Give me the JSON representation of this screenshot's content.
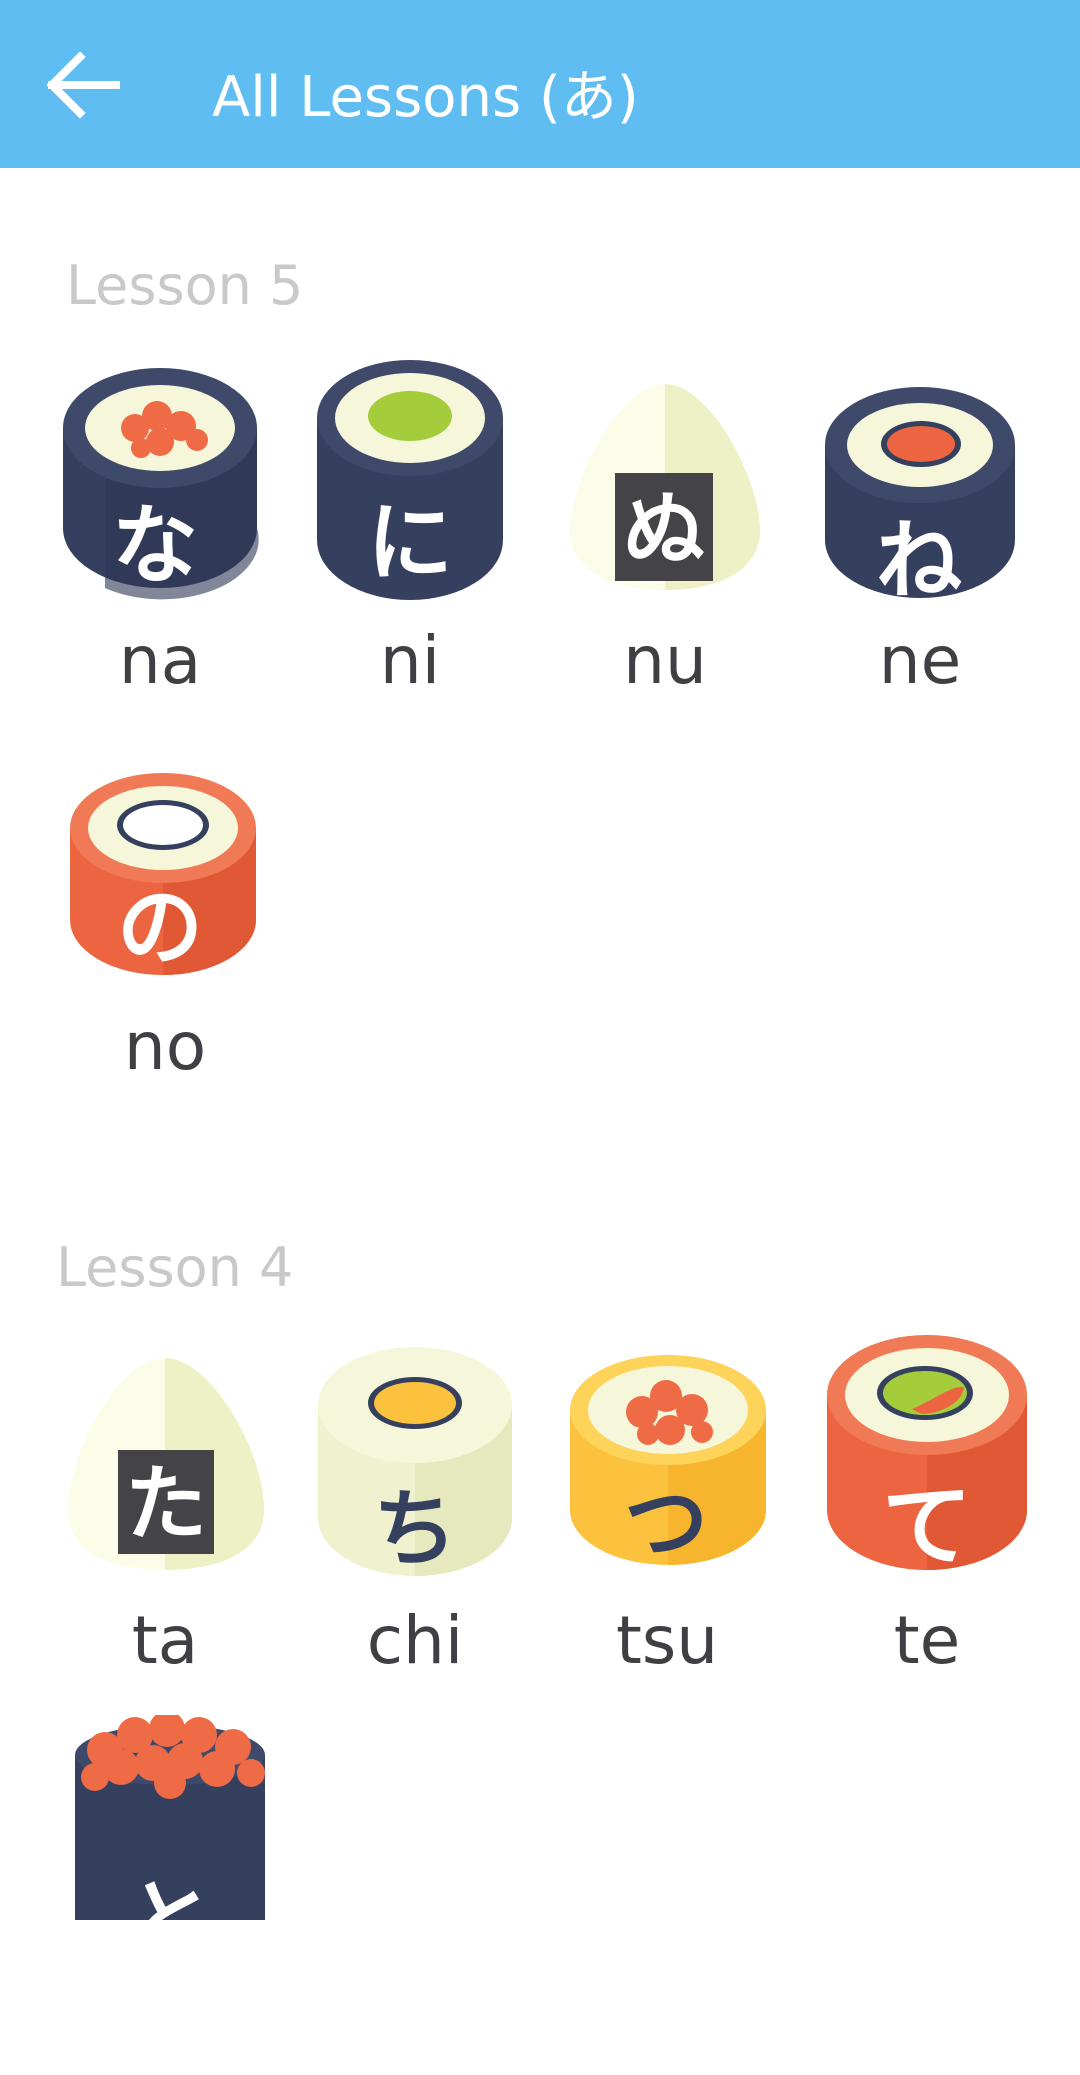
{
  "header": {
    "title": "All Lessons (あ)",
    "back_icon": "arrow-left-icon"
  },
  "colors": {
    "appbar": "#5fbdf2",
    "nori": "#35405f",
    "salmon": "#ec6540",
    "tamago": "#fdc23d",
    "rice": "#f5f6da",
    "roe": "#ef6b46",
    "cucumber": "#a4cc3b"
  },
  "lessons": [
    {
      "title": "Lesson 5",
      "items": [
        {
          "kana": "な",
          "romaji": "na",
          "icon": "nori-roll-salmon-roe-icon"
        },
        {
          "kana": "に",
          "romaji": "ni",
          "icon": "nori-roll-cucumber-icon"
        },
        {
          "kana": "ぬ",
          "romaji": "nu",
          "icon": "onigiri-icon"
        },
        {
          "kana": "ね",
          "romaji": "ne",
          "icon": "nori-roll-tuna-icon"
        },
        {
          "kana": "の",
          "romaji": "no",
          "icon": "salmon-roll-icon"
        }
      ]
    },
    {
      "title": "Lesson 4",
      "items": [
        {
          "kana": "た",
          "romaji": "ta",
          "icon": "onigiri-icon"
        },
        {
          "kana": "ち",
          "romaji": "chi",
          "icon": "rice-roll-egg-icon"
        },
        {
          "kana": "つ",
          "romaji": "tsu",
          "icon": "tamago-roll-roe-icon"
        },
        {
          "kana": "て",
          "romaji": "te",
          "icon": "salmon-roll-avocado-icon"
        },
        {
          "kana": "と",
          "romaji": "",
          "icon": "gunkan-roe-icon"
        }
      ]
    }
  ]
}
